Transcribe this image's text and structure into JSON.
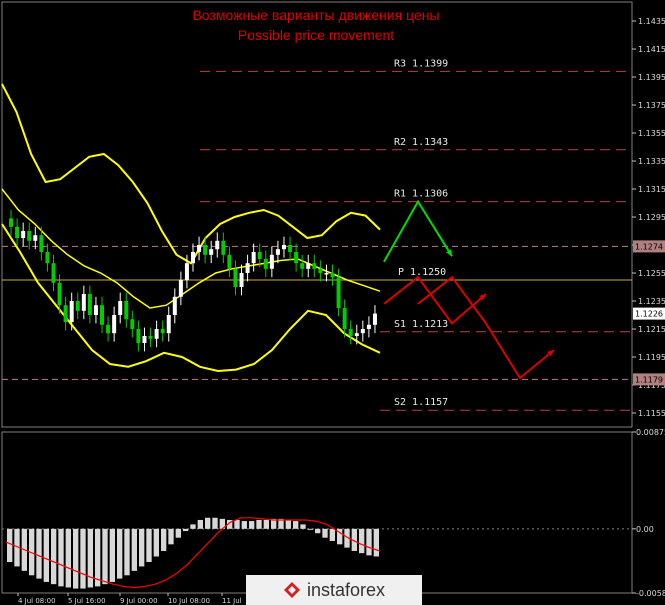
{
  "title_ru": "Возможные варианты движения цены",
  "title_en": "Possible price movement",
  "logo_text": "instaforex",
  "colors": {
    "background": "#000000",
    "grid": "#808080",
    "bull": "#ffffff",
    "bear": "#00cc00",
    "bands": "#ffff00",
    "ma": "#0000ff",
    "signal": "#ff0000",
    "up_arrow": "#00dd00",
    "down_arrow": "#dd0000",
    "title": "#e00000"
  },
  "chart_data": [
    {
      "type": "candlestick",
      "panel": "price",
      "ylim": [
        1.1145,
        1.144
      ],
      "y_ticks": [
        "1.1435",
        "1.1415",
        "1.1395",
        "1.1375",
        "1.1355",
        "1.1335",
        "1.1315",
        "1.1295",
        "1.1275",
        "1.1255",
        "1.1235",
        "1.1215",
        "1.1195",
        "1.1175",
        "1.1155"
      ],
      "price_tags": [
        {
          "value": 1.1274,
          "label": "1.1274",
          "kind": "highlight"
        },
        {
          "value": 1.1226,
          "label": "1.1226",
          "kind": "current"
        },
        {
          "value": 1.1179,
          "label": "1.1179",
          "kind": "highlight"
        }
      ],
      "levels": [
        {
          "name": "R3",
          "value": 1.1399,
          "label": "R3 1.1399",
          "style": "dashed"
        },
        {
          "name": "R2",
          "value": 1.1343,
          "label": "R2 1.1343",
          "style": "dashed"
        },
        {
          "name": "R1",
          "value": 1.1306,
          "label": "R1 1.1306",
          "style": "dashed"
        },
        {
          "name": "P",
          "value": 1.125,
          "label": "P 1.1250",
          "style": "solid"
        },
        {
          "name": "S1",
          "value": 1.1213,
          "label": "S1 1.1213",
          "style": "dashed"
        },
        {
          "name": "S2",
          "value": 1.1157,
          "label": "S2 1.1157",
          "style": "dashed"
        }
      ],
      "candles_close": [
        1.1288,
        1.128,
        1.1285,
        1.1278,
        1.1282,
        1.127,
        1.1262,
        1.1248,
        1.1232,
        1.122,
        1.1235,
        1.1228,
        1.124,
        1.1225,
        1.1232,
        1.1218,
        1.1212,
        1.1225,
        1.1235,
        1.1222,
        1.1215,
        1.1205,
        1.121,
        1.1208,
        1.1215,
        1.1212,
        1.1225,
        1.1238,
        1.125,
        1.1262,
        1.127,
        1.1275,
        1.1268,
        1.1272,
        1.1278,
        1.1268,
        1.1258,
        1.1245,
        1.1255,
        1.1262,
        1.127,
        1.1265,
        1.1258,
        1.1268,
        1.1272,
        1.1275,
        1.127,
        1.1262,
        1.1258,
        1.1262,
        1.1258,
        1.1255,
        1.1255,
        1.1252,
        1.123,
        1.1215,
        1.121,
        1.1212,
        1.1215,
        1.1218,
        1.1226
      ],
      "bollinger_upper": [
        1.139,
        1.137,
        1.134,
        1.132,
        1.1322,
        1.133,
        1.1338,
        1.134,
        1.1332,
        1.132,
        1.1305,
        1.1285,
        1.1268,
        1.1262,
        1.128,
        1.129,
        1.1295,
        1.1298,
        1.13,
        1.1296,
        1.1288,
        1.128,
        1.1282,
        1.1292,
        1.1298,
        1.1296,
        1.1286
      ],
      "bollinger_mid": [
        1.1315,
        1.13,
        1.129,
        1.1278,
        1.1268,
        1.126,
        1.1255,
        1.1248,
        1.1238,
        1.123,
        1.1232,
        1.124,
        1.1248,
        1.1255,
        1.1258,
        1.126,
        1.1262,
        1.1264,
        1.1265,
        1.126,
        1.1255,
        1.125,
        1.1246,
        1.1242
      ],
      "bollinger_lower": [
        1.129,
        1.127,
        1.1248,
        1.1232,
        1.1216,
        1.12,
        1.119,
        1.1188,
        1.1192,
        1.1198,
        1.1195,
        1.1188,
        1.1185,
        1.1186,
        1.119,
        1.12,
        1.1215,
        1.1228,
        1.1225,
        1.1212,
        1.1204,
        1.1198
      ],
      "arrows": [
        {
          "color": "up_arrow",
          "points": [
            [
              1.1263,
              0
            ],
            [
              1.1306,
              1
            ],
            [
              1.1267,
              2
            ]
          ]
        },
        {
          "color": "down_arrow",
          "points": [
            [
              1.1233,
              0
            ],
            [
              1.1252,
              1
            ],
            [
              1.1219,
              2
            ],
            [
              1.124,
              3
            ]
          ]
        },
        {
          "color": "down_arrow",
          "points": [
            [
              1.1233,
              1
            ],
            [
              1.1252,
              2
            ],
            [
              1.1219,
              3
            ],
            [
              1.118,
              4
            ],
            [
              1.12,
              5
            ]
          ]
        }
      ]
    },
    {
      "type": "bar",
      "panel": "oscillator",
      "ylim": [
        -0.0058,
        0.00875
      ],
      "y_ticks": [
        "0.00875",
        "0.00",
        "-0.0058"
      ],
      "values": [
        -0.003,
        -0.0034,
        -0.0038,
        -0.0042,
        -0.0045,
        -0.0048,
        -0.005,
        -0.0052,
        -0.0053,
        -0.0054,
        -0.0054,
        -0.0053,
        -0.0052,
        -0.005,
        -0.0048,
        -0.0045,
        -0.0042,
        -0.0038,
        -0.0034,
        -0.003,
        -0.0025,
        -0.002,
        -0.0014,
        -0.0008,
        -0.0002,
        0.0004,
        0.0008,
        0.001,
        0.001,
        0.0009,
        0.0008,
        0.0008,
        0.0007,
        0.0007,
        0.0008,
        0.0008,
        0.0009,
        0.0009,
        0.0008,
        0.0007,
        0.0004,
        0.0,
        -0.0004,
        -0.0008,
        -0.0011,
        -0.0014,
        -0.0017,
        -0.002,
        -0.0022,
        -0.0024,
        -0.0025
      ],
      "signal": [
        -0.0012,
        -0.0016,
        -0.002,
        -0.0024,
        -0.0028,
        -0.0032,
        -0.0036,
        -0.004,
        -0.0044,
        -0.0047,
        -0.005,
        -0.0052,
        -0.0053,
        -0.0052,
        -0.005,
        -0.0046,
        -0.004,
        -0.0032,
        -0.0022,
        -0.0012,
        -0.0002,
        0.0006,
        0.001,
        0.001,
        0.0009,
        0.0008,
        0.0008,
        0.0008,
        0.0008,
        0.0007,
        0.0004,
        -0.0002,
        -0.0008,
        -0.0013,
        -0.0017,
        -0.002
      ],
      "x_tick_labels": [
        "4 Jul 08:00",
        "5 Jul 16:00",
        "9 Jul 00:00",
        "10 Jul 08:00",
        "11 Jul"
      ]
    }
  ]
}
